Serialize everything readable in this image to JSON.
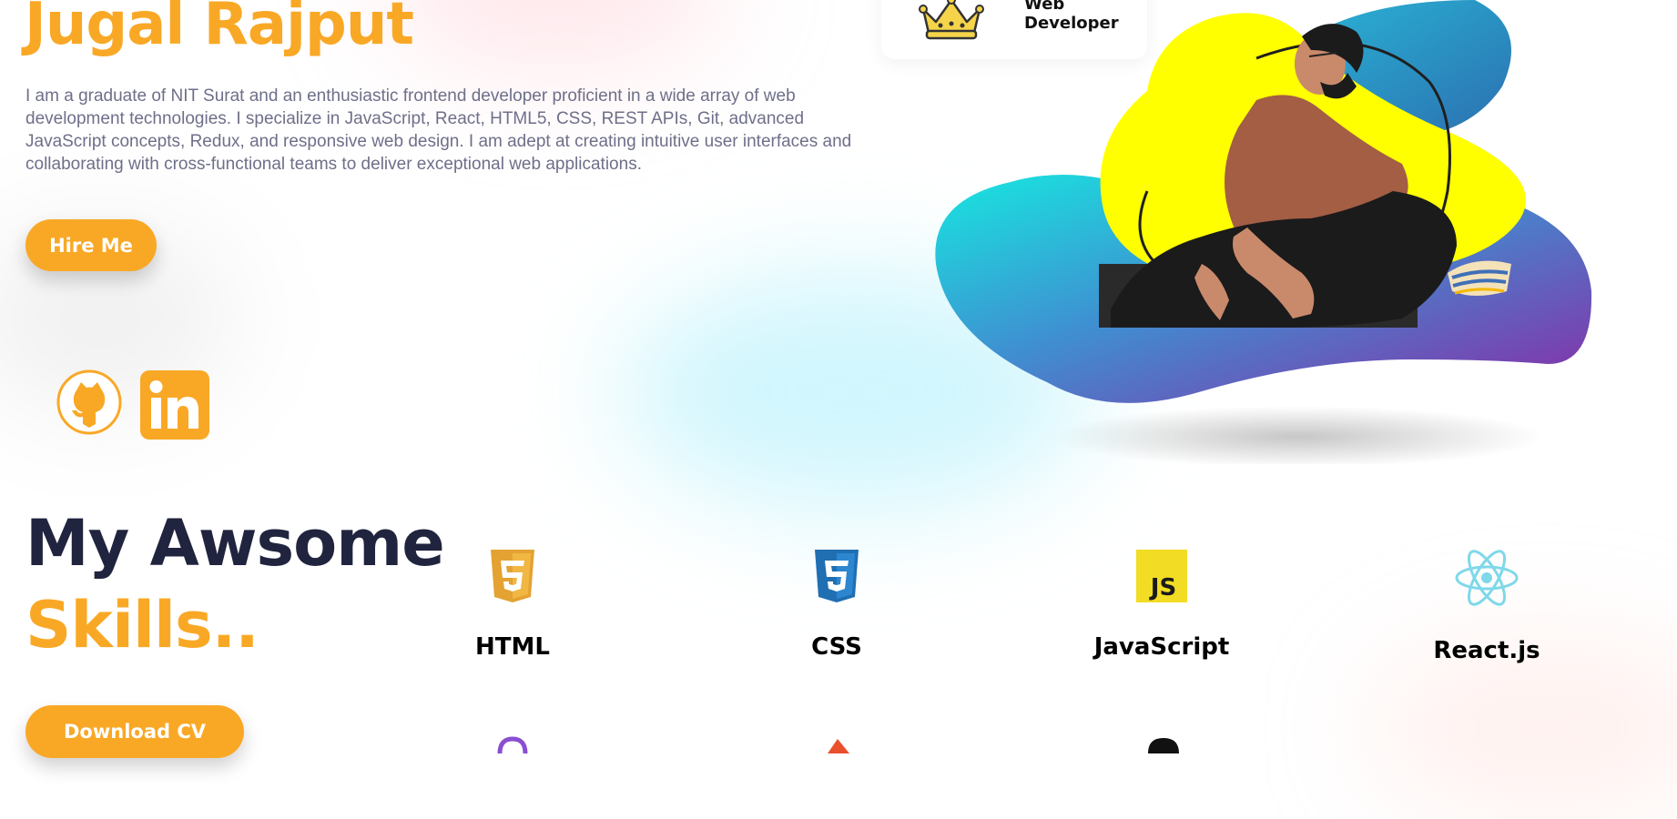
{
  "hero": {
    "name": "Jugal Rajput",
    "bio": "I am a graduate of NIT Surat and an enthusiastic frontend developer proficient in a wide array of web development technologies. I specialize in JavaScript, React, HTML5, CSS, REST APIs, Git, advanced JavaScript concepts, Redux, and responsive web design. I am adept at creating intuitive user interfaces and collaborating with cross-functional teams to deliver exceptional web applications.",
    "hire_label": "Hire Me",
    "badge_line1": "Web",
    "badge_line2": "Developer"
  },
  "social": [
    {
      "icon": "github-icon"
    },
    {
      "icon": "linkedin-icon"
    }
  ],
  "skills": {
    "title_line1": "My Awsome",
    "title_line2": "Skills..",
    "download_label": "Download CV",
    "items": [
      {
        "label": "HTML",
        "icon": "html5-icon"
      },
      {
        "label": "CSS",
        "icon": "css3-icon"
      },
      {
        "label": "JavaScript",
        "icon": "javascript-icon"
      },
      {
        "label": "React.js",
        "icon": "react-icon"
      }
    ]
  },
  "colors": {
    "accent": "#f9a826",
    "heading": "#20243e",
    "body_text": "#6e6f89"
  }
}
